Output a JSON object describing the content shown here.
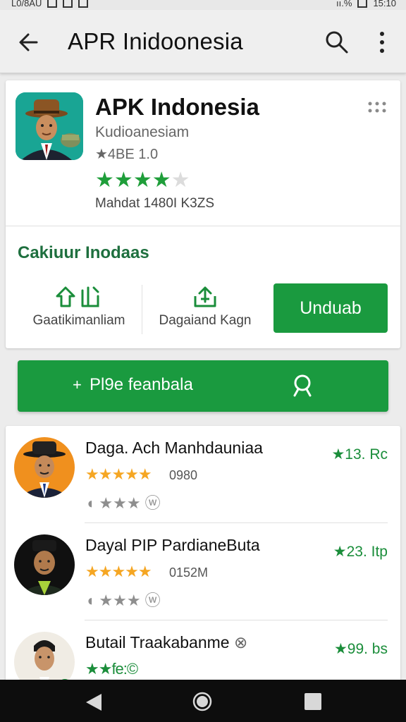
{
  "status_bar": {
    "left_text": "L0/8AU",
    "right_signal": "ıı.%",
    "time": "15:10"
  },
  "app_bar": {
    "title": "APR Inidoonesia",
    "icons": [
      "back-arrow-icon",
      "search-icon",
      "more-vert-icon"
    ]
  },
  "app_card": {
    "name": "APK Indonesia",
    "developer": "Kudioanesiam",
    "version": "★4BE 1.0",
    "stars": {
      "filled": 4,
      "total": 5
    },
    "meta": "Mahdat 1480I K3ZS",
    "section_title": "Cakiuur Inodaas",
    "actions": [
      {
        "label": "Gaatikimanliam",
        "icon": "share-icon"
      },
      {
        "label": "Dagaiand Kagn",
        "icon": "upload-icon"
      }
    ],
    "install_label": "Unduab"
  },
  "play_button": {
    "label": "Pl9e feanbala",
    "prefix": "+",
    "icon": "search-icon"
  },
  "list": [
    {
      "name": "Daga. Ach Manhdauniaa",
      "rating": "13. Rc",
      "count": "0980",
      "stars": "★★★★★",
      "actions": "◖ ★★★ ⓦ"
    },
    {
      "name": "Dayal PIP PardianeButa",
      "rating": "23. Itp",
      "count": "0152M",
      "stars": "★★★★★",
      "actions": "◖ ★★★ ⓦ"
    },
    {
      "name": "Butail Traakabanme",
      "rating": "99. bs",
      "count": "",
      "stars": "★★fe:©",
      "actions": ""
    }
  ],
  "colors": {
    "accent_green": "#1a9a3f",
    "rating_green": "#1a8d3a",
    "star_gold": "#f5a623",
    "nav_bar": "#0d0d0d"
  }
}
